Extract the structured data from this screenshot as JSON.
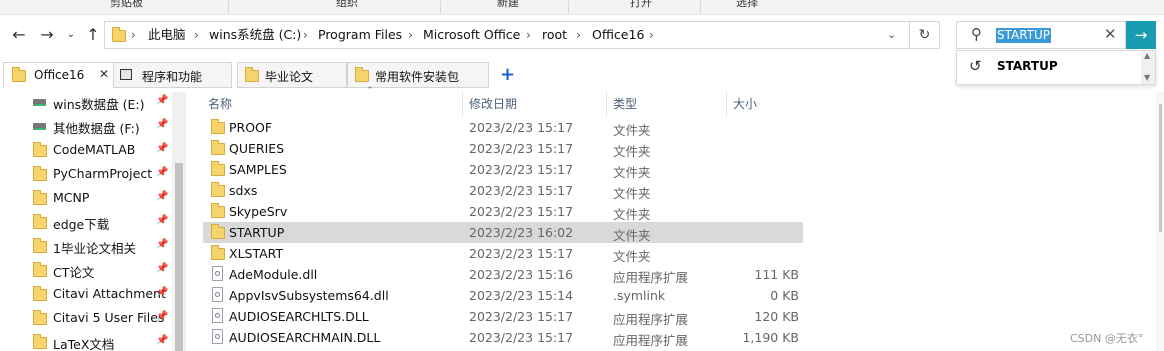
{
  "ribbon": {
    "labels": [
      "剪贴板",
      "组织",
      "新建",
      "打开",
      "选择"
    ]
  },
  "address": {
    "crumbs": [
      "此电脑",
      "wins系统盘 (C:)",
      "Program Files",
      "Microsoft Office",
      "root",
      "Office16"
    ]
  },
  "search": {
    "value": "STARTUP",
    "suggestion": "STARTUP"
  },
  "tabs": [
    {
      "label": "Office16",
      "active": true
    },
    {
      "label": "程序和功能",
      "active": false
    },
    {
      "label": "毕业论文",
      "active": false
    },
    {
      "label": "常用软件安装包",
      "active": false
    }
  ],
  "nav": {
    "items": [
      {
        "label": "wins数据盘 (E:)",
        "kind": "drive"
      },
      {
        "label": "其他数据盘 (F:)",
        "kind": "drive"
      },
      {
        "label": "CodeMATLAB",
        "kind": "folder"
      },
      {
        "label": "PyCharmProject",
        "kind": "folder"
      },
      {
        "label": "MCNP",
        "kind": "folder"
      },
      {
        "label": "edge下载",
        "kind": "folder"
      },
      {
        "label": "1毕业论文相关",
        "kind": "folder"
      },
      {
        "label": "CT论文",
        "kind": "folder"
      },
      {
        "label": "Citavi Attachment",
        "kind": "folder"
      },
      {
        "label": "Citavi 5 User Files",
        "kind": "folder"
      },
      {
        "label": "LaTeX文档",
        "kind": "folder"
      }
    ]
  },
  "columns": {
    "name": "名称",
    "date": "修改日期",
    "type": "类型",
    "size": "大小"
  },
  "files": [
    {
      "name": "PROOF",
      "date": "2023/2/23 15:17",
      "type": "文件夹",
      "size": "",
      "kind": "folder"
    },
    {
      "name": "QUERIES",
      "date": "2023/2/23 15:17",
      "type": "文件夹",
      "size": "",
      "kind": "folder"
    },
    {
      "name": "SAMPLES",
      "date": "2023/2/23 15:17",
      "type": "文件夹",
      "size": "",
      "kind": "folder"
    },
    {
      "name": "sdxs",
      "date": "2023/2/23 15:17",
      "type": "文件夹",
      "size": "",
      "kind": "folder"
    },
    {
      "name": "SkypeSrv",
      "date": "2023/2/23 15:17",
      "type": "文件夹",
      "size": "",
      "kind": "folder"
    },
    {
      "name": "STARTUP",
      "date": "2023/2/23 16:02",
      "type": "文件夹",
      "size": "",
      "kind": "folder",
      "selected": true
    },
    {
      "name": "XLSTART",
      "date": "2023/2/23 15:17",
      "type": "文件夹",
      "size": "",
      "kind": "folder"
    },
    {
      "name": "AdeModule.dll",
      "date": "2023/2/23 15:16",
      "type": "应用程序扩展",
      "size": "111 KB",
      "kind": "file"
    },
    {
      "name": "AppvIsvSubsystems64.dll",
      "date": "2023/2/23 15:14",
      "type": ".symlink",
      "size": "0 KB",
      "kind": "file"
    },
    {
      "name": "AUDIOSEARCHLTS.DLL",
      "date": "2023/2/23 15:17",
      "type": "应用程序扩展",
      "size": "120 KB",
      "kind": "file"
    },
    {
      "name": "AUDIOSEARCHMAIN.DLL",
      "date": "2023/2/23 15:17",
      "type": "应用程序扩展",
      "size": "1,190 KB",
      "kind": "file"
    }
  ],
  "watermark": "CSDN @无衣°"
}
